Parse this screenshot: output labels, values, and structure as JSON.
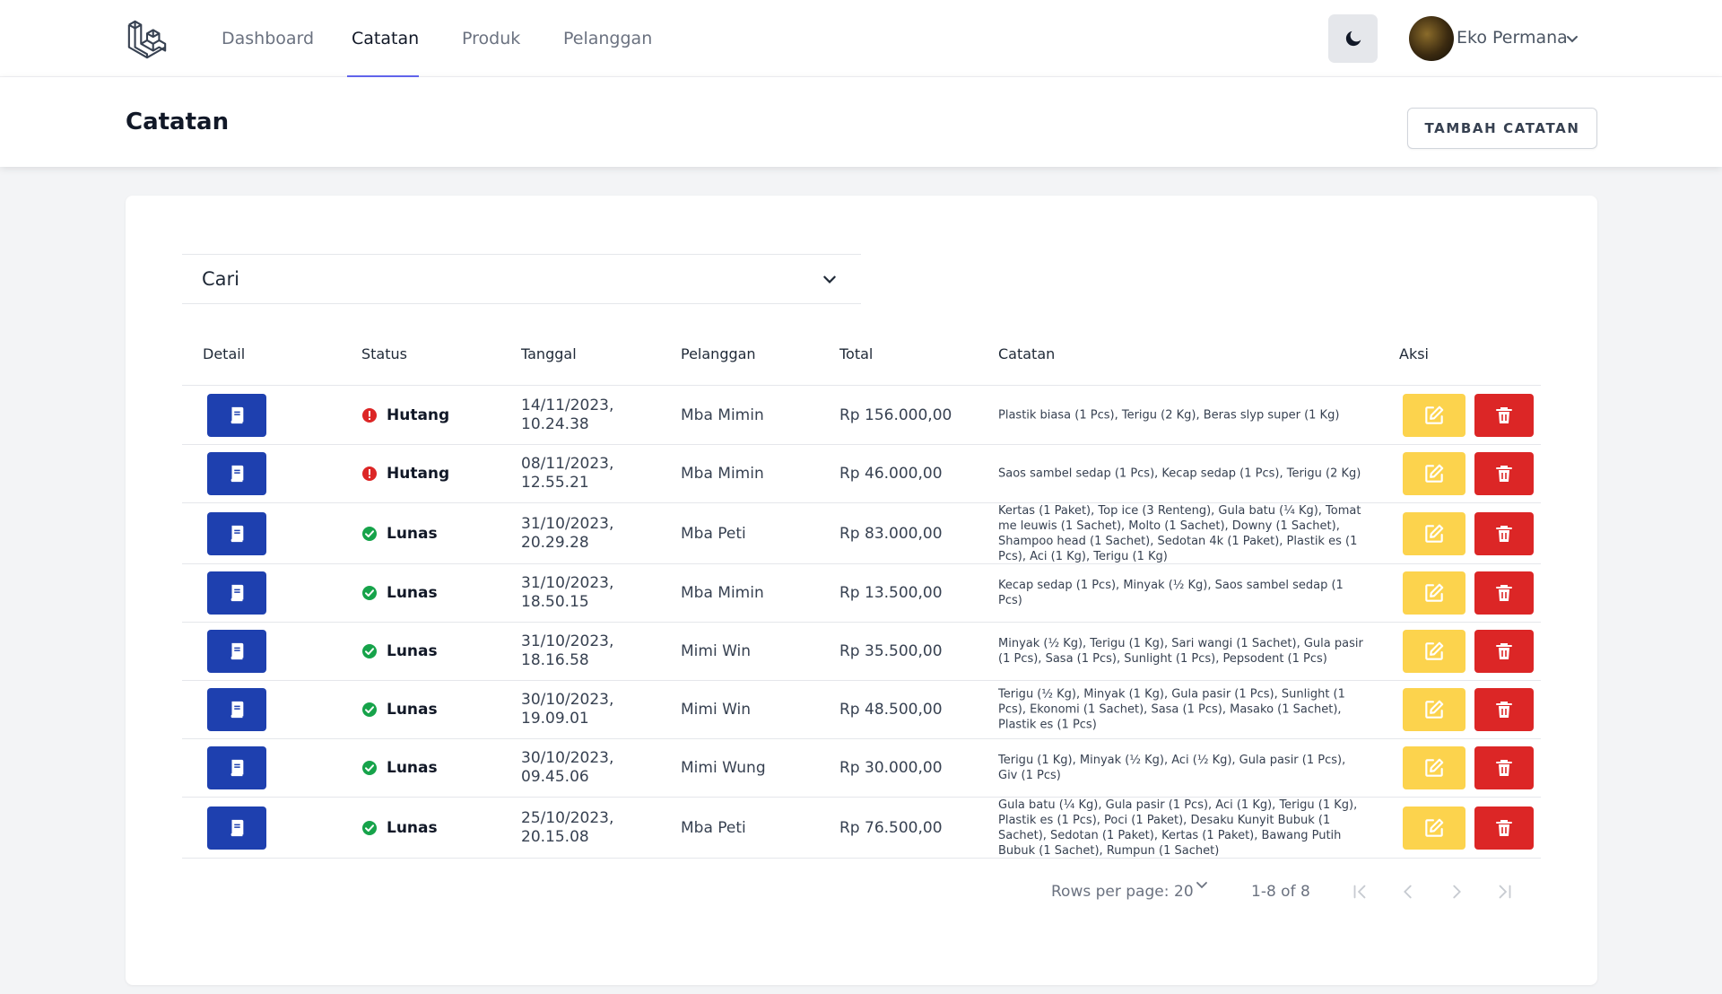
{
  "nav": {
    "links": [
      "Dashboard",
      "Catatan",
      "Produk",
      "Pelanggan"
    ],
    "active": "Catatan",
    "user_name": "Eko Permana"
  },
  "header": {
    "title": "Catatan",
    "add_button": "TAMBAH CATATAN"
  },
  "search": {
    "label": "Cari"
  },
  "table": {
    "columns": [
      "Detail",
      "Status",
      "Tanggal",
      "Pelanggan",
      "Total",
      "Catatan",
      "Aksi"
    ],
    "rows": [
      {
        "status": "Hutang",
        "date_line1": "14/11/2023,",
        "date_line2": "10.24.38",
        "customer": "Mba Mimin",
        "total": "Rp 156.000,00",
        "note": "Plastik biasa (1 Pcs), Terigu (2 Kg), Beras slyp super (1 Kg)"
      },
      {
        "status": "Hutang",
        "date_line1": "08/11/2023,",
        "date_line2": "12.55.21",
        "customer": "Mba Mimin",
        "total": "Rp 46.000,00",
        "note": "Saos sambel sedap (1 Pcs), Kecap sedap (1 Pcs), Terigu (2 Kg)"
      },
      {
        "status": "Lunas",
        "date_line1": "31/10/2023,",
        "date_line2": "20.29.28",
        "customer": "Mba Peti",
        "total": "Rp 83.000,00",
        "note": "Kertas (1 Paket), Top ice (3 Renteng), Gula batu (¼ Kg), Tomat me leuwis (1 Sachet), Molto (1 Sachet), Downy (1 Sachet), Shampoo head (1 Sachet), Sedotan 4k (1 Paket), Plastik es (1 Pcs), Aci (1 Kg), Terigu (1 Kg)"
      },
      {
        "status": "Lunas",
        "date_line1": "31/10/2023,",
        "date_line2": "18.50.15",
        "customer": "Mba Mimin",
        "total": "Rp 13.500,00",
        "note": "Kecap sedap (1 Pcs), Minyak (½ Kg), Saos sambel sedap (1 Pcs)"
      },
      {
        "status": "Lunas",
        "date_line1": "31/10/2023,",
        "date_line2": "18.16.58",
        "customer": "Mimi Win",
        "total": "Rp 35.500,00",
        "note": "Minyak (½ Kg), Terigu (1 Kg), Sari wangi (1 Sachet), Gula pasir (1 Pcs), Sasa (1 Pcs), Sunlight (1 Pcs), Pepsodent (1 Pcs)"
      },
      {
        "status": "Lunas",
        "date_line1": "30/10/2023,",
        "date_line2": "19.09.01",
        "customer": "Mimi Win",
        "total": "Rp 48.500,00",
        "note": "Terigu (½ Kg), Minyak (1 Kg), Gula pasir (1 Pcs), Sunlight (1 Pcs), Ekonomi (1 Sachet), Sasa (1 Pcs), Masako (1 Sachet), Plastik es (1 Pcs)"
      },
      {
        "status": "Lunas",
        "date_line1": "30/10/2023,",
        "date_line2": "09.45.06",
        "customer": "Mimi Wung",
        "total": "Rp 30.000,00",
        "note": "Terigu (1 Kg), Minyak (½ Kg), Aci (½ Kg), Gula pasir (1 Pcs), Giv (1 Pcs)"
      },
      {
        "status": "Lunas",
        "date_line1": "25/10/2023,",
        "date_line2": "20.15.08",
        "customer": "Mba Peti",
        "total": "Rp 76.500,00",
        "note": "Gula batu (¼ Kg), Gula pasir (1 Pcs), Aci (1 Kg), Terigu (1 Kg), Plastik es (1 Pcs), Poci (1 Paket), Desaku Kunyit Bubuk (1 Sachet), Sedotan (1 Paket), Kertas (1 Paket), Bawang Putih Bubuk (1 Sachet), Rumpun (1 Sachet)"
      }
    ]
  },
  "pagination": {
    "rows_per_page_label": "Rows per page:",
    "rows_per_page_value": "20",
    "range": "1-8 of 8"
  },
  "colors": {
    "detail_button": "#1e40af",
    "edit_button": "#fcd34d",
    "delete_button": "#dc2626",
    "hutang": "#dc2626",
    "lunas": "#16a34a",
    "nav_active_underline": "#6366f1"
  }
}
